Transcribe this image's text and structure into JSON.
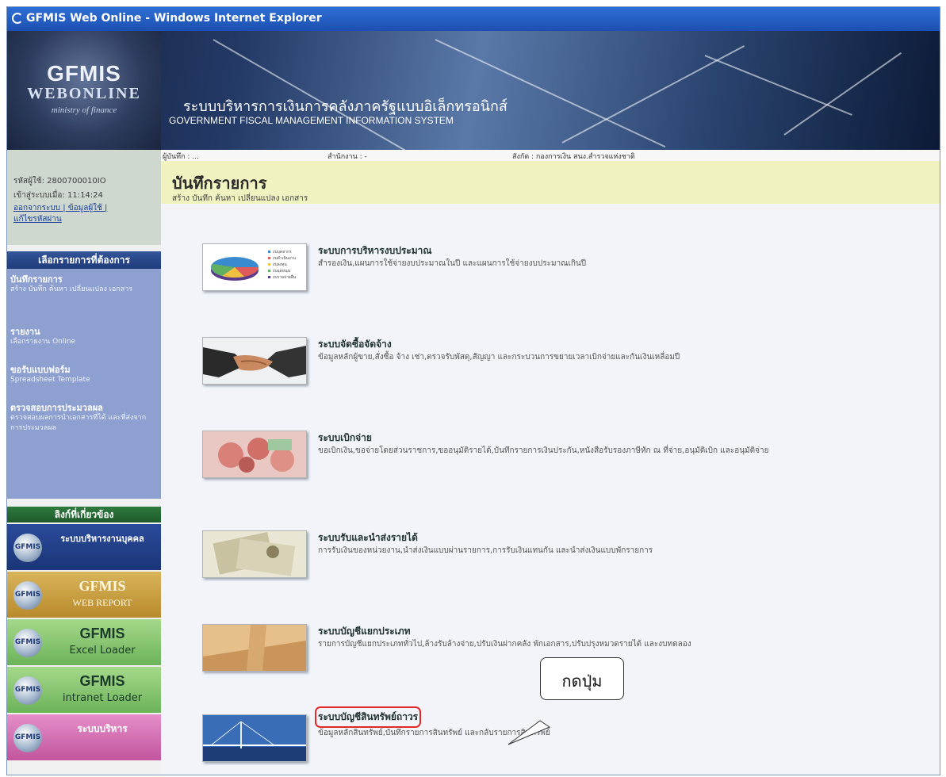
{
  "window": {
    "title": "GFMIS Web Online - Windows Internet Explorer"
  },
  "banner": {
    "logo_line1": "GFMIS",
    "logo_line2": "WEBONLINE",
    "logo_line3": "ministry of finance",
    "title_th": "ระบบบริหารการเงินการคลังภาครัฐแบบอิเล็กทรอนิกส์",
    "title_en": "GOVERNMENT FISCAL MANAGEMENT INFORMATION SYSTEM"
  },
  "sidebar": {
    "user_id": "รหัสผู้ใช้: 2800700010IO",
    "login_time": "เข้าสู่ระบบเมื่อ: 11:14:24",
    "logout_link": "ออกจากระบบ | ข้อมูลผู้ใช้ |",
    "change_password_link": "แก้ไขรหัสผ่าน",
    "menu_header": "เลือกรายการที่ต้องการ",
    "menu_items": [
      {
        "title": "บันทึกรายการ",
        "sub": "สร้าง บันทึก ค้นหา เปลี่ยนแปลง เอกสาร"
      },
      {
        "title": "รายงาน",
        "sub": "เลือกรายงาน Online"
      },
      {
        "title": "ขอรับแบบฟอร์ม",
        "sub": "Spreadsheet Template"
      },
      {
        "title": "ตรวจสอบการประมวลผล",
        "sub": "ตรวจสอบผลการนำเอกสารที่ได้ และที่ส่งจากการประมวลผล"
      }
    ],
    "links_header": "ลิงก์ที่เกี่ยวข้อง",
    "quick_links": [
      {
        "title": "ระบบบริหารงานบุคคล",
        "sub": ""
      },
      {
        "title": "GFMIS",
        "sub": "WEB REPORT"
      },
      {
        "title": "GFMIS",
        "sub": "Excel Loader"
      },
      {
        "title": "GFMIS",
        "sub": "intranet Loader"
      },
      {
        "title": "ระบบบริหาร",
        "sub": ""
      }
    ]
  },
  "infobar": {
    "recorder": "ผู้บันทึก : ...",
    "office": "สำนักงาน : -",
    "affiliation": "สังกัด : กองการเงิน สนง.สำรวจแห่งชาติ"
  },
  "header": {
    "title": "บันทึกรายการ",
    "subtitle": "สร้าง บันทึก ค้นหา เปลี่ยนแปลง เอกสาร"
  },
  "systems": [
    {
      "title": "ระบบการบริหารงบประมาณ",
      "desc": "สำรองเงิน,แผนการใช้จ่ายงบประมาณในปี และแผนการใช้จ่ายงบประมาณเกินปี"
    },
    {
      "title": "ระบบจัดซื้อจัดจ้าง",
      "desc": "ข้อมูลหลักผู้ขาย,สั่งซื้อ จ้าง เช่า,ตรวจรับพัสดุ,สัญญา และกระบวนการขยายเวลาเบิกจ่ายและกันเงินเหลื่อมปี"
    },
    {
      "title": "ระบบเบิกจ่าย",
      "desc": "ขอเบิกเงิน,ขอจ่ายโดยส่วนราชการ,ขออนุมัติรายได้,บันทึกรายการเงินประกัน,หนังสือรับรองภาษีหัก ณ ที่จ่าย,อนุมัติเบิก และอนุมัติจ่าย"
    },
    {
      "title": "ระบบรับและนำส่งรายได้",
      "desc": "การรับเงินของหน่วยงาน,นำส่งเงินแบบผ่านรายการ,การรับเงินแทนกัน และนำส่งเงินแบบพักรายการ"
    },
    {
      "title": "ระบบบัญชีแยกประเภท",
      "desc": "รายการบัญชีแยกประเภททั่วไป,ล้างรับล้างจ่าย,ปรับเงินฝากคลัง พักเอกสาร,ปรับปรุงหมวดรายได้ และงบทดลอง"
    },
    {
      "title": "ระบบบัญชีสินทรัพย์ถาวร",
      "desc": "ข้อมูลหลักสินทรัพย์,บันทึกรายการสินทรัพย์ และกลับรายการสินทรัพย์"
    }
  ],
  "callout": {
    "text": "กดปุ่ม"
  },
  "pie_legend": [
    "งบบุคลากร",
    "งบดำเนินงาน",
    "งบลงทุน",
    "งบอุดหนุน",
    "งบรายจ่ายอื่น"
  ],
  "colors": {
    "highlight": "#e02a2a",
    "header_bg": "#f0f3c0",
    "menu_bg": "#8ea0cf"
  }
}
